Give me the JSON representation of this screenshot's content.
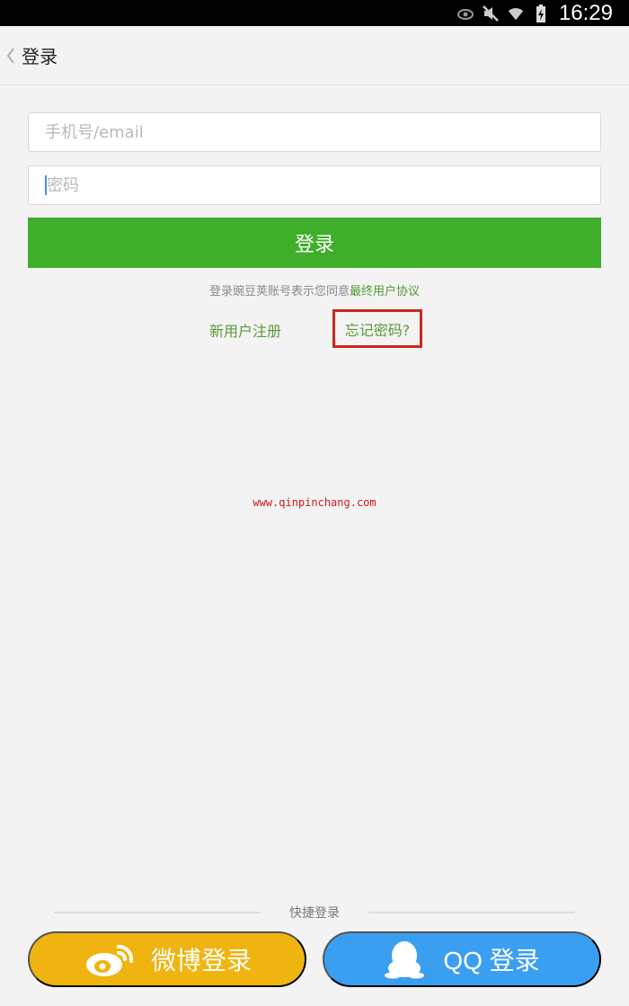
{
  "status_bar": {
    "time": "16:29",
    "icons": [
      "eye-icon",
      "mute-icon",
      "wifi-icon",
      "battery-charging-icon"
    ]
  },
  "header": {
    "back_icon": "chevron-left-icon",
    "title": "登录"
  },
  "form": {
    "account_placeholder": "手机号/email",
    "account_value": "",
    "password_placeholder": "密码",
    "password_value": "",
    "login_label": "登录"
  },
  "agreement": {
    "prefix": "登录豌豆荚账号表示您同意",
    "link": "最终用户协议"
  },
  "links": {
    "register": "新用户注册",
    "forgot": "忘记密码?"
  },
  "watermark": "www.qinpinchang.com",
  "quick_login": {
    "label": "快捷登录",
    "weibo_label": "微博登录",
    "qq_label": "QQ 登录"
  },
  "colors": {
    "login_button": "#3fae2a",
    "weibo_button": "#f0b411",
    "qq_button": "#3a9ff0",
    "link_green": "#5a9a38",
    "highlight_red": "#c8281e"
  }
}
